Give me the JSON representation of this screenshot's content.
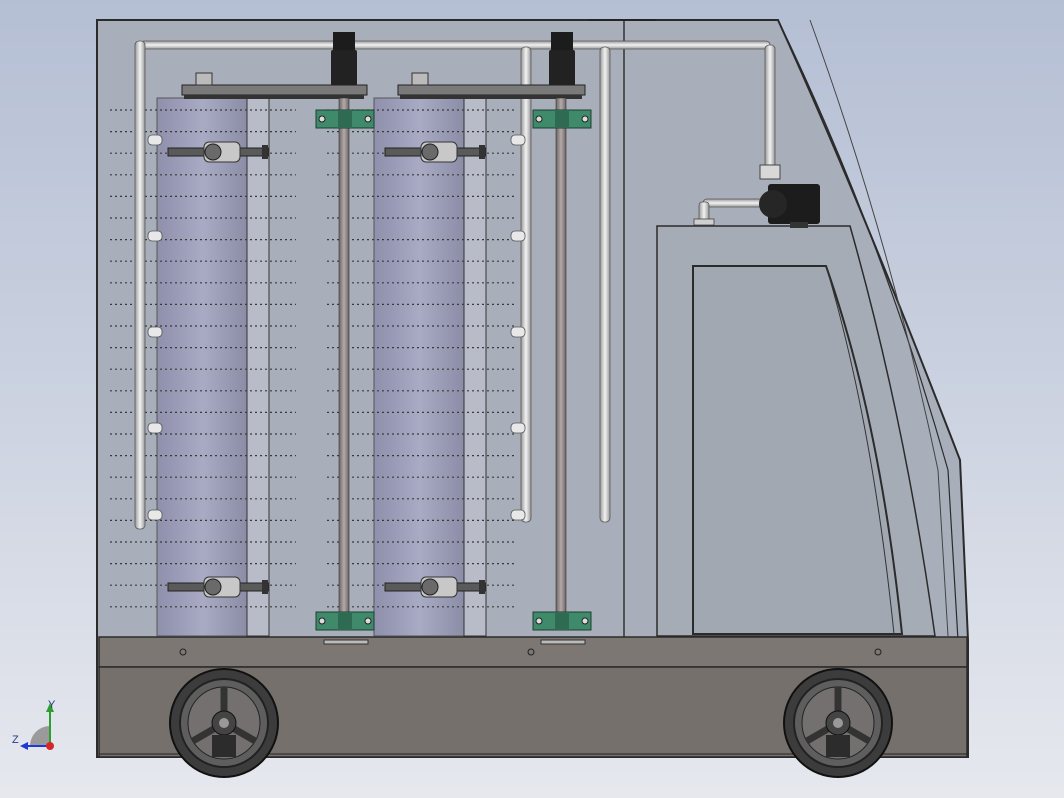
{
  "view": {
    "triad": {
      "axis_y": "Y",
      "axis_z": "Z"
    }
  },
  "colors": {
    "frame_fill": "#a7adb8",
    "frame_stroke": "#2b2b2b",
    "base_fill": "#7f7a76",
    "brush_fill": "#9b9cb8",
    "pipe_fill": "#d8d8d8",
    "bracket_green": "#3f8a6b",
    "motor_black": "#1c1c1c",
    "wheel_dark": "#4a4a4a",
    "cabinet_fill": "#a4aab4"
  }
}
